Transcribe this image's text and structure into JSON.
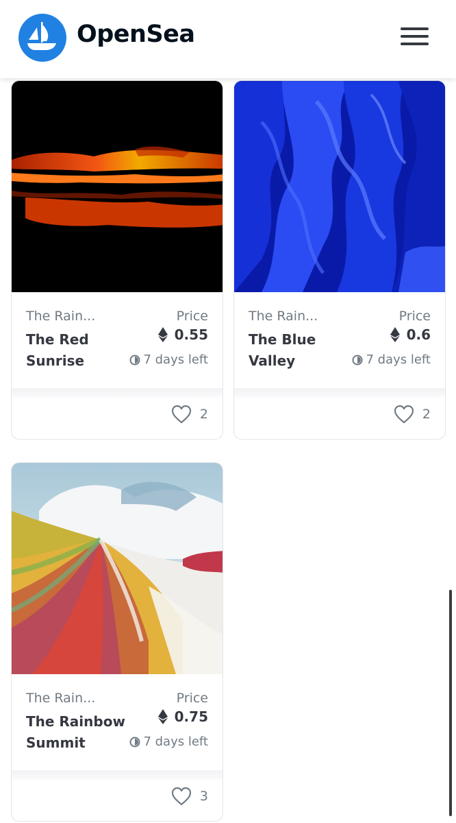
{
  "app": {
    "brand": "OpenSea",
    "logo_icon": "opensea-sailboat-logo-icon",
    "menu_icon": "hamburger-menu-icon",
    "accent_color": "#2081e2"
  },
  "cards": [
    {
      "collection": "The Rain...",
      "title": "The Red Sunrise",
      "price_label": "Price",
      "currency_icon": "ethereum-icon",
      "price": "0.55",
      "time_left": "7 days left",
      "likes": "2",
      "image": "red-sunrise-artwork"
    },
    {
      "collection": "The Rain...",
      "title": "The Blue Valley",
      "price_label": "Price",
      "currency_icon": "ethereum-icon",
      "price": "0.6",
      "time_left": "7 days left",
      "likes": "2",
      "image": "blue-valley-artwork"
    },
    {
      "collection": "The Rain...",
      "title": "The Rainbow Summit",
      "price_label": "Price",
      "currency_icon": "ethereum-icon",
      "price": "0.75",
      "time_left": "7 days left",
      "likes": "3",
      "image": "rainbow-summit-artwork"
    }
  ]
}
